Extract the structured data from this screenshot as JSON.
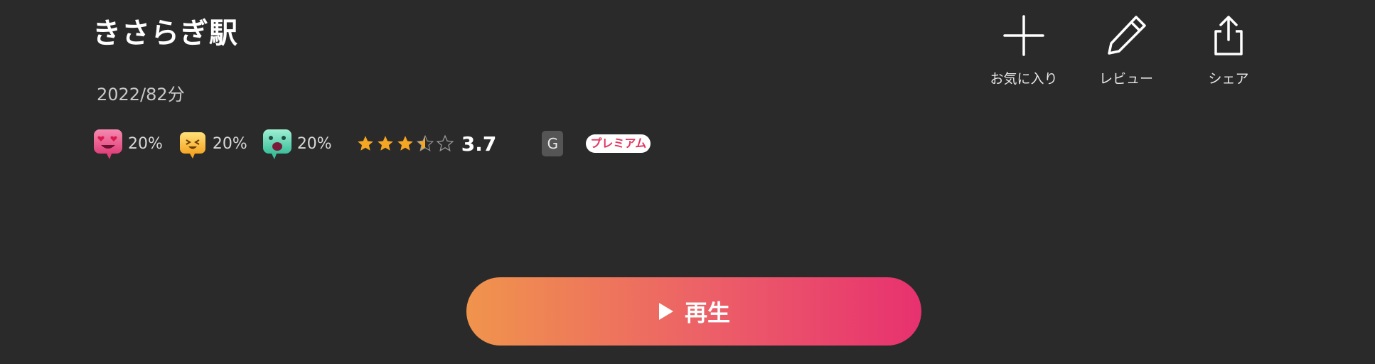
{
  "title": "きさらぎ駅",
  "meta": "2022/82分",
  "reactions": [
    {
      "icon": "heart-eyes-reaction-icon",
      "percent": "20%"
    },
    {
      "icon": "laughing-reaction-icon",
      "percent": "20%"
    },
    {
      "icon": "scared-reaction-icon",
      "percent": "20%"
    }
  ],
  "rating": {
    "value": 3.7,
    "label": "3.7",
    "max": 5
  },
  "rating_badge": "G",
  "premium_badge": "プレミアム",
  "actions": {
    "favorite": "お気に入り",
    "review": "レビュー",
    "share": "シェア"
  },
  "play_label": "再生",
  "colors": {
    "background": "#2a2a2a",
    "play_gradient_start": "#f0944c",
    "play_gradient_end": "#e7316f",
    "star": "#f5a623",
    "premium_text": "#e3365f"
  }
}
